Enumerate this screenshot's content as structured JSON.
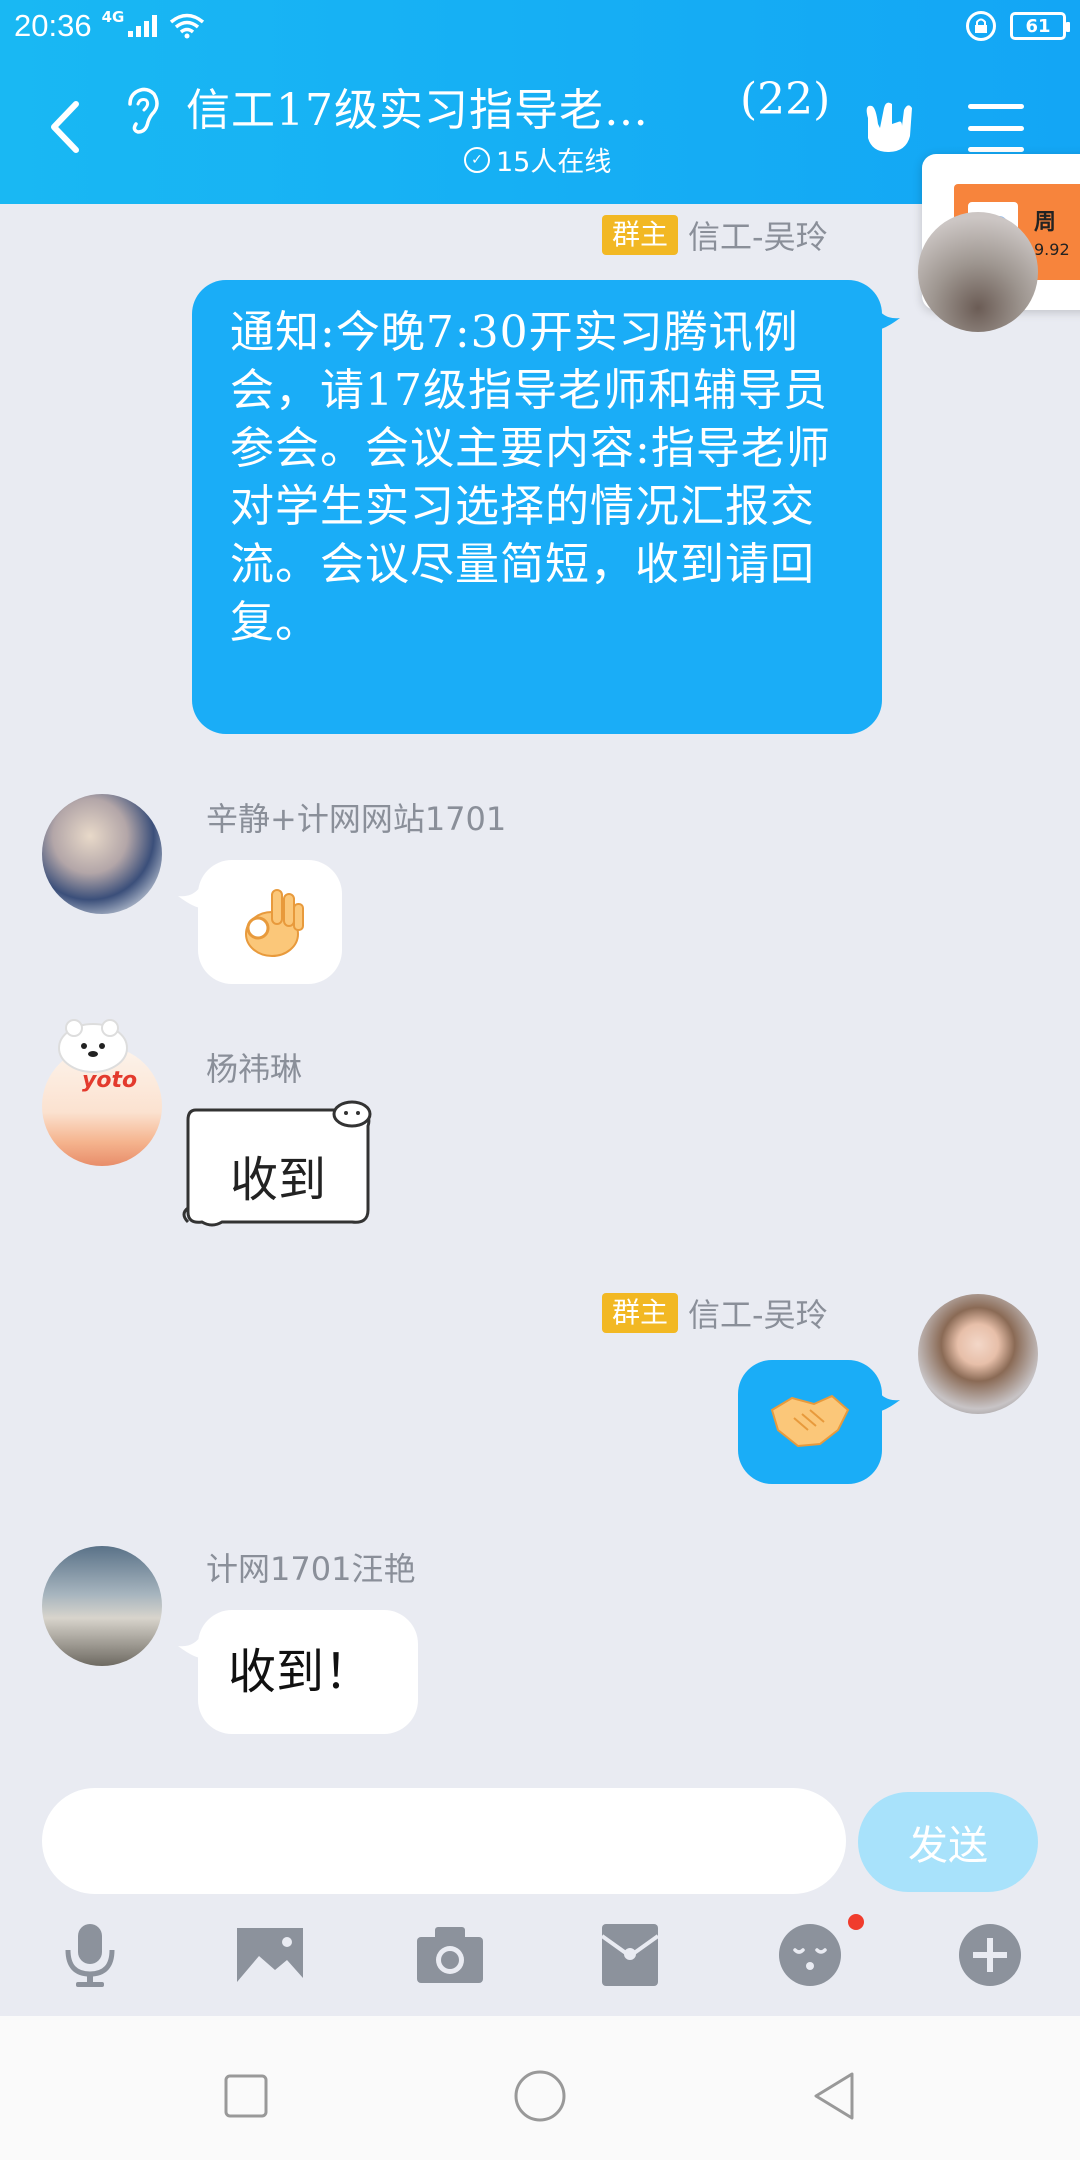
{
  "status": {
    "time": "20:36",
    "network": "4G",
    "battery": "61"
  },
  "header": {
    "title": "信工17级实习指导老…",
    "count": "(22)",
    "online": "15人在线"
  },
  "float_card": {
    "title": "周",
    "subtitle": "9.92"
  },
  "messages": {
    "m1": {
      "badge": "群主",
      "sender": "信工-吴玲",
      "text": "通知:今晚7:30开实习腾讯例会，请17级指导老师和辅导员参会。会议主要内容:指导老师对学生实习选择的情况汇报交流。会议尽量简短，收到请回复。"
    },
    "m2": {
      "sender": "辛静+计网网站1701",
      "emoji": "ok-hand"
    },
    "m3": {
      "sender": "杨祎琳",
      "sticker_text": "收到"
    },
    "m4": {
      "badge": "群主",
      "sender": "信工-吴玲",
      "emoji": "handshake"
    },
    "m5": {
      "sender": "计网1701汪艳",
      "text": "收到！"
    }
  },
  "input": {
    "placeholder": "",
    "send_label": "发送"
  },
  "toolbar": [
    "mic-icon",
    "image-icon",
    "camera-icon",
    "red-packet-icon",
    "emoji-icon",
    "plus-icon"
  ],
  "colors": {
    "header": "#13a6f5",
    "outgoing_bubble": "#1aadf7",
    "badge": "#f2b823",
    "send_button": "#a8e2fb"
  }
}
